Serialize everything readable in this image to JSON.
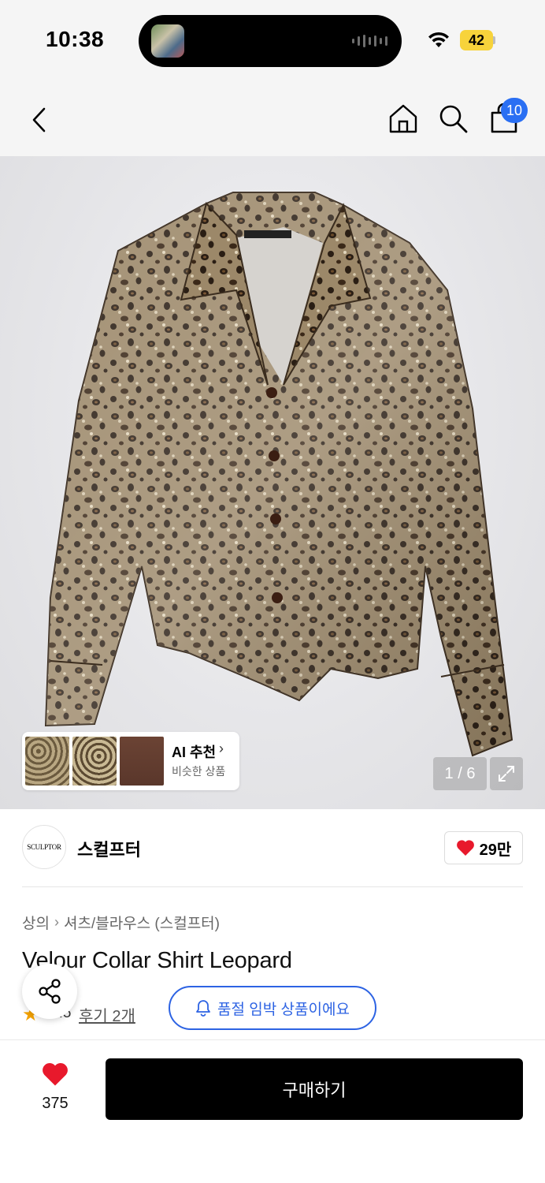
{
  "status_bar": {
    "time": "10:38",
    "battery": "42"
  },
  "header": {
    "cart_badge": "10"
  },
  "gallery": {
    "counter": "1 / 6",
    "ai_card": {
      "title": "AI 추천",
      "subtitle": "비슷한 상품"
    }
  },
  "brand": {
    "logo_text": "SCULPTOR",
    "name": "스컬프터",
    "likes": "29만"
  },
  "product": {
    "breadcrumb": [
      "상의",
      "셔츠/블라우스 (스컬프터)"
    ],
    "title": "Velour Collar Shirt Leopard",
    "rating": "4.5",
    "review_label": "후기 2개",
    "stock_notice": "품절 임박 상품이에요"
  },
  "bottom_bar": {
    "like_count": "375",
    "buy_label": "구매하기"
  },
  "colors": {
    "accent_blue": "#2d63e3",
    "badge_blue": "#2a6ff3",
    "heart_red": "#e8192c",
    "battery_yellow": "#f7d33b"
  }
}
